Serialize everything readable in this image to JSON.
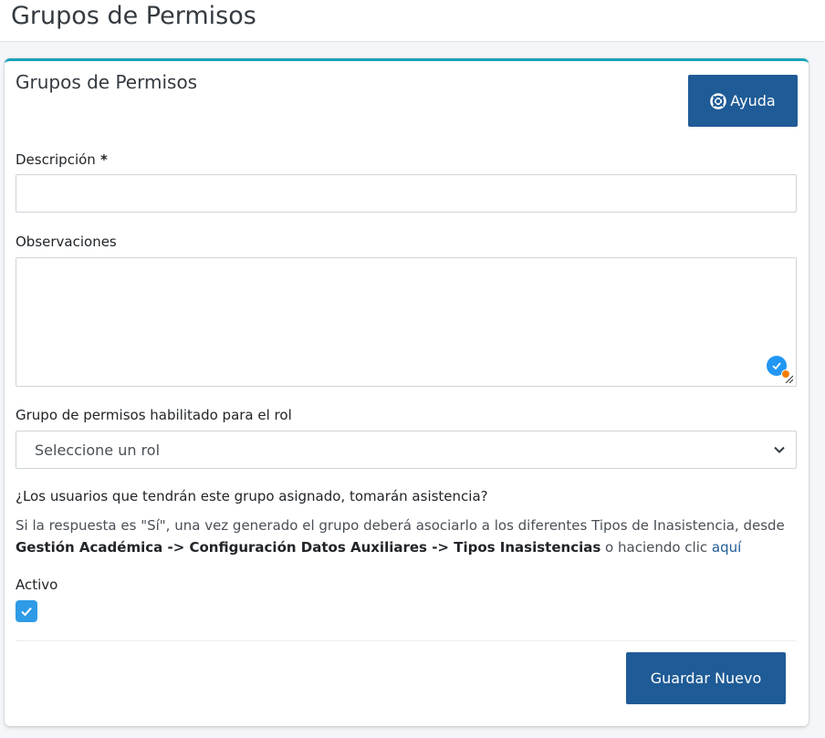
{
  "page": {
    "title": "Grupos de Permisos"
  },
  "card": {
    "title": "Grupos de Permisos",
    "help_label": "Ayuda",
    "help_icon": "life-ring-icon"
  },
  "form": {
    "descripcion": {
      "label": "Descripción",
      "required_mark": " *",
      "value": ""
    },
    "observaciones": {
      "label": "Observaciones",
      "value": ""
    },
    "rol": {
      "label": "Grupo de permisos habilitado para el rol",
      "selected": "Seleccione un rol"
    },
    "question": "¿Los usuarios que tendrán este grupo asignado, tomarán asistencia?",
    "info": {
      "text_1": "Si la respuesta es \"Sí\", una vez generado el grupo deberá asociarlo a los diferentes Tipos de Inasistencia, desde ",
      "path": "Gestión Académica -> Configuración Datos Auxiliares -> Tipos Inasistencias",
      "text_2": " o haciendo clic ",
      "link": "aquí"
    },
    "activo": {
      "label": "Activo",
      "checked": true
    },
    "save_label": "Guardar Nuevo"
  },
  "colors": {
    "primary": "#1f5b96",
    "card_accent": "#17a2b8",
    "checkbox": "#2e9be6"
  }
}
